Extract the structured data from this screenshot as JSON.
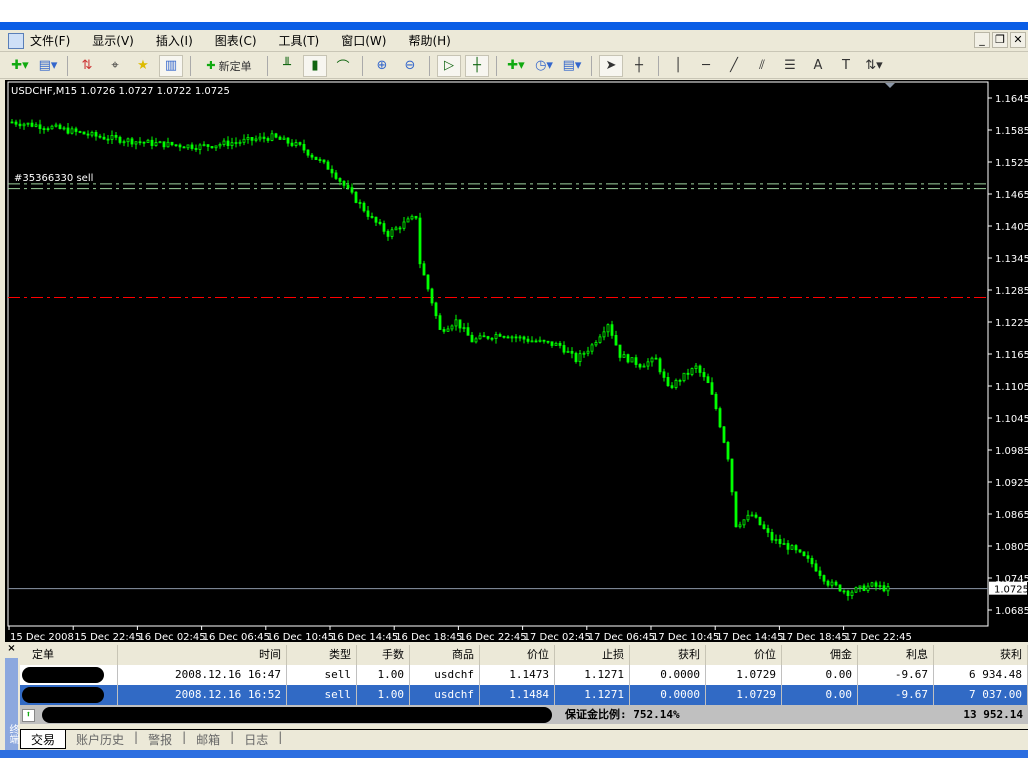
{
  "menu": [
    "文件(F)",
    "显示(V)",
    "插入(I)",
    "图表(C)",
    "工具(T)",
    "窗口(W)",
    "帮助(H)"
  ],
  "toolbar": {
    "new_order": "新定单"
  },
  "chart_info": "USDCHF,M15  1.0726 1.0727 1.0722 1.0725",
  "order_label": "#35366330 sell",
  "chart_data": {
    "type": "candlestick",
    "symbol": "USDCHF",
    "timeframe": "M15",
    "ylim": [
      1.0655,
      1.1675
    ],
    "y_ticks": [
      "1.1645",
      "1.1585",
      "1.1525",
      "1.1465",
      "1.1405",
      "1.1345",
      "1.1285",
      "1.1225",
      "1.1165",
      "1.1105",
      "1.1045",
      "1.0985",
      "1.0925",
      "1.0865",
      "1.0805",
      "1.0745",
      "1.0685"
    ],
    "x_ticks": [
      "15 Dec 2008",
      "15 Dec 22:45",
      "16 Dec 02:45",
      "16 Dec 06:45",
      "16 Dec 10:45",
      "16 Dec 14:45",
      "16 Dec 18:45",
      "16 Dec 22:45",
      "17 Dec 02:45",
      "17 Dec 06:45",
      "17 Dec 10:45",
      "17 Dec 14:45",
      "17 Dec 18:45",
      "17 Dec 22:45"
    ],
    "current_price": "1.0725",
    "order_lines": [
      1.1475,
      1.1484
    ],
    "stop_loss_line": 1.1271,
    "candle_count": 219,
    "close_waypoints": [
      [
        0,
        1.16
      ],
      [
        10,
        1.159
      ],
      [
        22,
        1.1572
      ],
      [
        35,
        1.156
      ],
      [
        47,
        1.1554
      ],
      [
        57,
        1.1563
      ],
      [
        65,
        1.1572
      ],
      [
        72,
        1.1554
      ],
      [
        80,
        1.1509
      ],
      [
        85,
        1.1463
      ],
      [
        90,
        1.1418
      ],
      [
        94,
        1.139
      ],
      [
        97,
        1.1405
      ],
      [
        101,
        1.1423
      ],
      [
        102,
        1.1336
      ],
      [
        105,
        1.1263
      ],
      [
        107,
        1.1209
      ],
      [
        111,
        1.1227
      ],
      [
        115,
        1.119
      ],
      [
        122,
        1.1203
      ],
      [
        130,
        1.119
      ],
      [
        137,
        1.1181
      ],
      [
        141,
        1.1154
      ],
      [
        145,
        1.1181
      ],
      [
        149,
        1.1223
      ],
      [
        152,
        1.1163
      ],
      [
        157,
        1.1145
      ],
      [
        161,
        1.1154
      ],
      [
        164,
        1.11
      ],
      [
        167,
        1.1118
      ],
      [
        171,
        1.114
      ],
      [
        174,
        1.1109
      ],
      [
        176,
        1.1063
      ],
      [
        179,
        1.0972
      ],
      [
        181,
        1.0845
      ],
      [
        185,
        1.0863
      ],
      [
        190,
        1.0818
      ],
      [
        195,
        1.08
      ],
      [
        200,
        1.0772
      ],
      [
        204,
        1.0736
      ],
      [
        209,
        1.0718
      ],
      [
        215,
        1.0731
      ],
      [
        219,
        1.0724
      ]
    ]
  },
  "terminal": {
    "side_label": "终端",
    "headers": [
      "定单",
      "时间",
      "类型",
      "手数",
      "商品",
      "价位",
      "止损",
      "获利",
      "价位",
      "佣金",
      "利息",
      "获利"
    ],
    "rows": [
      {
        "time": "2008.12.16 16:47",
        "type": "sell",
        "lots": "1.00",
        "symbol": "usdchf",
        "open": "1.1473",
        "sl": "1.1271",
        "tp": "0.0000",
        "price": "1.0729",
        "commission": "0.00",
        "swap": "-9.67",
        "profit": "6 934.48"
      },
      {
        "time": "2008.12.16 16:52",
        "type": "sell",
        "lots": "1.00",
        "symbol": "usdchf",
        "open": "1.1484",
        "sl": "1.1271",
        "tp": "0.0000",
        "price": "1.0729",
        "commission": "0.00",
        "swap": "-9.67",
        "profit": "7 037.00"
      }
    ],
    "margin_level": "保证金比例:  752.14%",
    "total": "13 952.14",
    "tabs": [
      "交易",
      "账户历史",
      "警报",
      "邮箱",
      "日志"
    ]
  },
  "colors": {
    "candle": "#00ff00",
    "stop_line": "#ff0000",
    "selected_row": "#316ac5"
  }
}
